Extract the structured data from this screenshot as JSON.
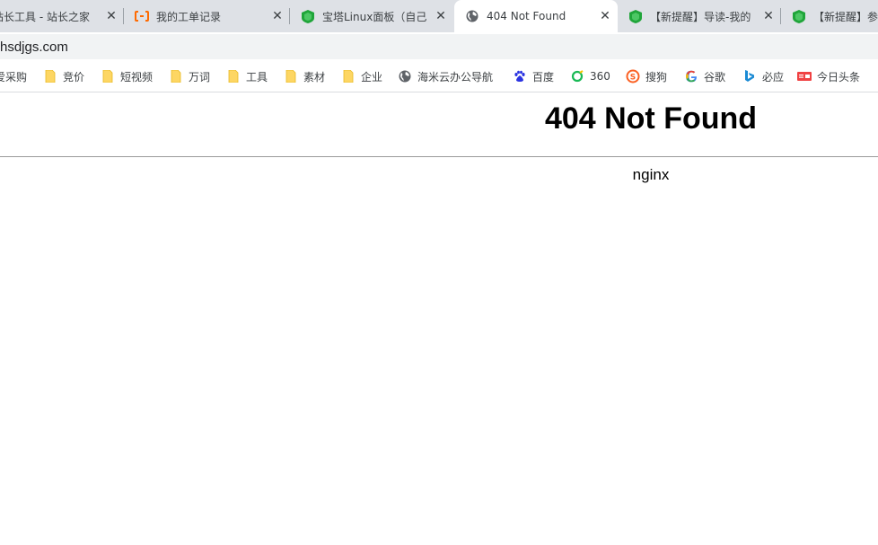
{
  "tabs": [
    {
      "title": "站长工具 - 站长之家",
      "icon": "chinaz-favicon",
      "active": false
    },
    {
      "title": "我的工单记录",
      "icon": "aliyun-favicon",
      "active": false
    },
    {
      "title": "宝塔Linux面板（自己",
      "icon": "bt-panel-favicon",
      "active": false
    },
    {
      "title": "404 Not Found",
      "icon": "globe-icon",
      "active": true
    },
    {
      "title": "【新提醒】导读-我的",
      "icon": "bt-panel-favicon",
      "active": false
    },
    {
      "title": "【新提醒】参",
      "icon": "bt-panel-favicon",
      "active": false
    }
  ],
  "address_bar": {
    "url": "hsdjgs.com"
  },
  "bookmarks": [
    {
      "label": "爱采购",
      "icon": "folder-icon"
    },
    {
      "label": "竞价",
      "icon": "folder-icon"
    },
    {
      "label": "短视频",
      "icon": "folder-icon"
    },
    {
      "label": "万词",
      "icon": "folder-icon"
    },
    {
      "label": "工具",
      "icon": "folder-icon"
    },
    {
      "label": "素材",
      "icon": "folder-icon"
    },
    {
      "label": "企业",
      "icon": "folder-icon"
    },
    {
      "label": "海米云办公导航",
      "icon": "globe-icon"
    },
    {
      "label": "百度",
      "icon": "baidu-icon"
    },
    {
      "label": "360",
      "icon": "360-icon"
    },
    {
      "label": "搜狗",
      "icon": "sogou-icon"
    },
    {
      "label": "谷歌",
      "icon": "google-icon"
    },
    {
      "label": "必应",
      "icon": "bing-icon"
    },
    {
      "label": "今日头条",
      "icon": "toutiao-icon"
    }
  ],
  "page": {
    "title": "404 Not Found",
    "server": "nginx"
  },
  "colors": {
    "tab_strip": "#dee1e6",
    "active_tab": "#ffffff",
    "omnibox": "#f1f3f4",
    "folder": "#fdd663",
    "bt_green": "#20a53a",
    "aliyun_orange": "#ff6a00",
    "baidu_blue": "#2932e1"
  }
}
